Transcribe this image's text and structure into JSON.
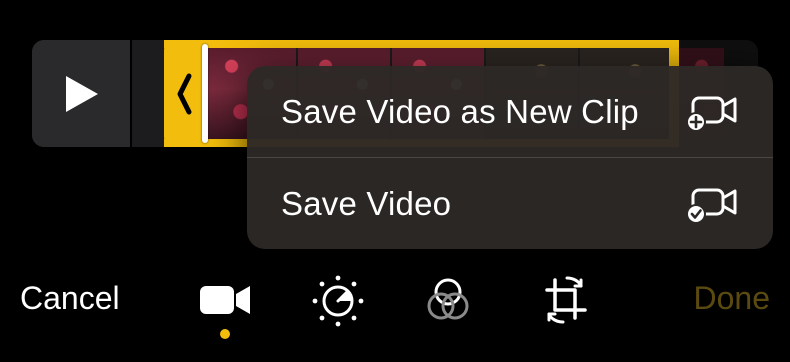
{
  "timeline": {
    "play_icon": "play-icon",
    "trim_handle_icon": "chevron-left-icon"
  },
  "menu": {
    "items": [
      {
        "label": "Save Video as New Clip",
        "icon": "video-plus-icon"
      },
      {
        "label": "Save Video",
        "icon": "video-check-icon"
      }
    ]
  },
  "toolbar": {
    "cancel_label": "Cancel",
    "done_label": "Done",
    "tools": [
      {
        "name": "video",
        "icon": "video-camera-icon",
        "active": true
      },
      {
        "name": "adjust",
        "icon": "adjust-dial-icon",
        "active": false
      },
      {
        "name": "filters",
        "icon": "filters-icon",
        "active": false
      },
      {
        "name": "crop",
        "icon": "crop-rotate-icon",
        "active": false
      }
    ]
  },
  "colors": {
    "accent": "#f2bd0c",
    "menu_background": "#2c2826",
    "done_disabled": "#5b4a10"
  }
}
